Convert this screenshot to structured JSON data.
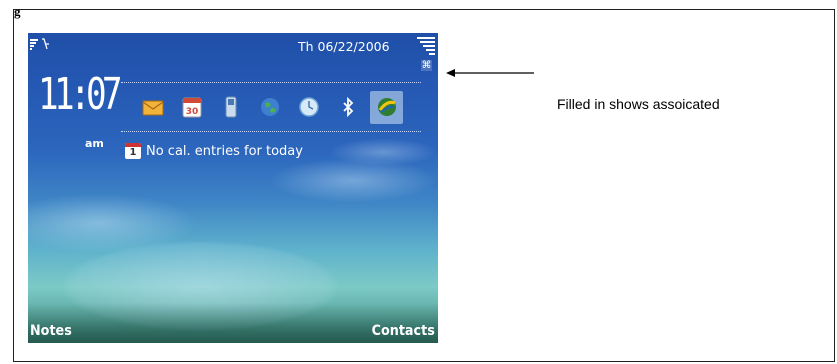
{
  "status": {
    "date": "Th 06/22/2006"
  },
  "clock": {
    "time": "11:07",
    "ampm": "am"
  },
  "active_indicator": "⌘",
  "apps": [
    {
      "icon": "mail-icon",
      "color": "#f0b030"
    },
    {
      "icon": "calendar-icon",
      "color": "#d04a3a",
      "text": "30"
    },
    {
      "icon": "phone-icon",
      "color": "#a9c3dd"
    },
    {
      "icon": "globe-icon",
      "color": "#3a8a40"
    },
    {
      "icon": "clock-icon",
      "color": "#6fa7d8"
    },
    {
      "icon": "bluetooth-icon",
      "color": "#ffffff"
    },
    {
      "icon": "web-icon",
      "color": "#2e7d32",
      "selected": true
    }
  ],
  "calendar": {
    "icon_text": "1",
    "text": "No cal. entries for today"
  },
  "softkeys": {
    "left": "Notes",
    "right": "Contacts"
  },
  "annotation": {
    "text": "Filled in shows assoicated"
  },
  "figure_label": "g"
}
